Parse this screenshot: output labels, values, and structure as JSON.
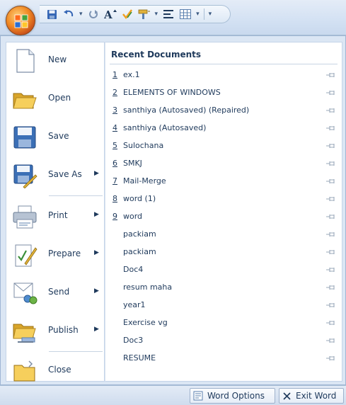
{
  "quick_access": {
    "items": [
      "save-icon",
      "undo-icon",
      "redo-icon",
      "grow-font-icon",
      "spelling-icon",
      "format-painter-icon",
      "align-icon",
      "table-icon"
    ],
    "customize_caret": "▾"
  },
  "menu": {
    "commands": [
      {
        "label": "New",
        "icon": "new-document-icon",
        "submenu": false
      },
      {
        "label": "Open",
        "icon": "open-folder-icon",
        "submenu": false
      },
      {
        "label": "Save",
        "icon": "save-disk-icon",
        "submenu": false
      },
      {
        "label": "Save As",
        "icon": "save-as-icon",
        "submenu": true
      },
      {
        "label": "Print",
        "icon": "printer-icon",
        "submenu": true
      },
      {
        "label": "Prepare",
        "icon": "prepare-icon",
        "submenu": true
      },
      {
        "label": "Send",
        "icon": "send-icon",
        "submenu": true
      },
      {
        "label": "Publish",
        "icon": "publish-icon",
        "submenu": true
      },
      {
        "label": "Close",
        "icon": "close-folder-icon",
        "submenu": false
      }
    ],
    "submenu_arrow": "▶"
  },
  "recent": {
    "header": "Recent Documents",
    "documents": [
      {
        "num": "1",
        "name": "ex.1"
      },
      {
        "num": "2",
        "name": "ELEMENTS OF WINDOWS"
      },
      {
        "num": "3",
        "name": "santhiya (Autosaved) (Repaired)"
      },
      {
        "num": "4",
        "name": "santhiya (Autosaved)"
      },
      {
        "num": "5",
        "name": "Sulochana"
      },
      {
        "num": "6",
        "name": "SMKJ"
      },
      {
        "num": "7",
        "name": "Mail-Merge"
      },
      {
        "num": "8",
        "name": "word (1)"
      },
      {
        "num": "9",
        "name": "word"
      },
      {
        "num": "",
        "name": "packiam"
      },
      {
        "num": "",
        "name": "packiam"
      },
      {
        "num": "",
        "name": "Doc4"
      },
      {
        "num": "",
        "name": "resum maha"
      },
      {
        "num": "",
        "name": "year1"
      },
      {
        "num": "",
        "name": "Exercise vg"
      },
      {
        "num": "",
        "name": "Doc3"
      },
      {
        "num": "",
        "name": "RESUME"
      }
    ]
  },
  "footer": {
    "word_options_label": "Word Options",
    "exit_word_label": "Exit Word"
  }
}
